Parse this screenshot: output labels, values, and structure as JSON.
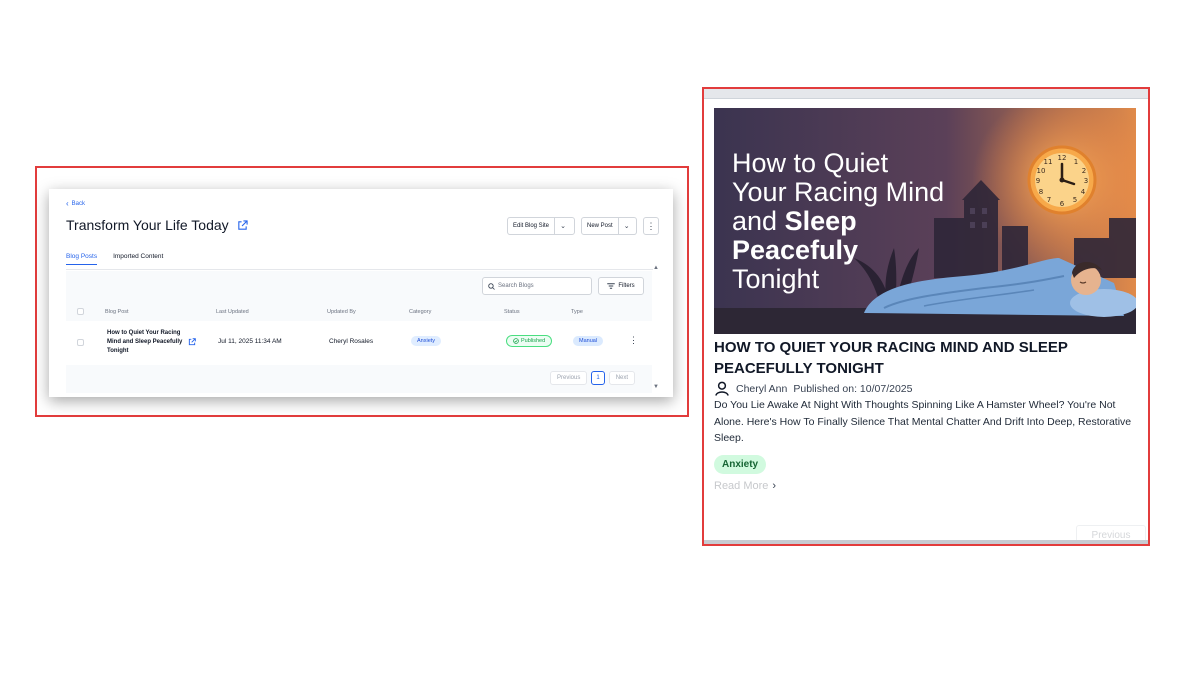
{
  "admin": {
    "back_label": "Back",
    "site_title": "Transform Your Life Today",
    "toolbar": {
      "edit_site_label": "Edit Blog Site",
      "new_post_label": "New Post"
    },
    "tabs": [
      {
        "label": "Blog Posts",
        "active": true
      },
      {
        "label": "Imported Content",
        "active": false
      }
    ],
    "search": {
      "placeholder": "Search Blogs"
    },
    "filters_label": "Filters",
    "columns": [
      "Blog Post",
      "Last Updated",
      "Updated By",
      "Category",
      "Status",
      "Type"
    ],
    "rows": [
      {
        "title": "How to Quiet Your Racing Mind and Sleep Peacefully Tonight",
        "last_updated": "Jul 11, 2025 11:34 AM",
        "updated_by": "Cheryl Rosales",
        "category": "Anxiety",
        "status": "Published",
        "type": "Manual"
      }
    ],
    "pagination": {
      "previous_label": "Previous",
      "current_page": "1",
      "next_label": "Next"
    }
  },
  "preview": {
    "hero_text": {
      "line1": "How to Quiet",
      "line2": "Your Racing Mind",
      "line3_a": "and ",
      "line3_b": "Sleep",
      "line4": "Peacefuly",
      "line5": "Tonight"
    },
    "heading": "HOW TO QUIET YOUR RACING MIND AND SLEEP PEACEFULLY TONIGHT",
    "author": "Cheryl Ann",
    "published": "Published on: 10/07/2025",
    "excerpt": "Do You Lie Awake At Night With Thoughts Spinning Like A Hamster Wheel? You're Not Alone. Here's How To Finally Silence That Mental Chatter And Drift Into Deep, Restorative Sleep.",
    "tag": "Anxiety",
    "read_more": "Read More",
    "prev_ghost": "Previous"
  },
  "colors": {
    "accent": "#2563eb",
    "frame": "#e23c3c",
    "tag_bg": "#d1fadf",
    "hero_bg": "#3d3552",
    "sun": "#f5a142"
  },
  "icons": [
    "chevron-left-icon",
    "external-link-icon",
    "chevron-down-icon",
    "kebab-menu-icon",
    "search-icon",
    "filter-icon",
    "check-circle-icon",
    "user-icon",
    "chevron-right-icon",
    "clock-icon"
  ]
}
